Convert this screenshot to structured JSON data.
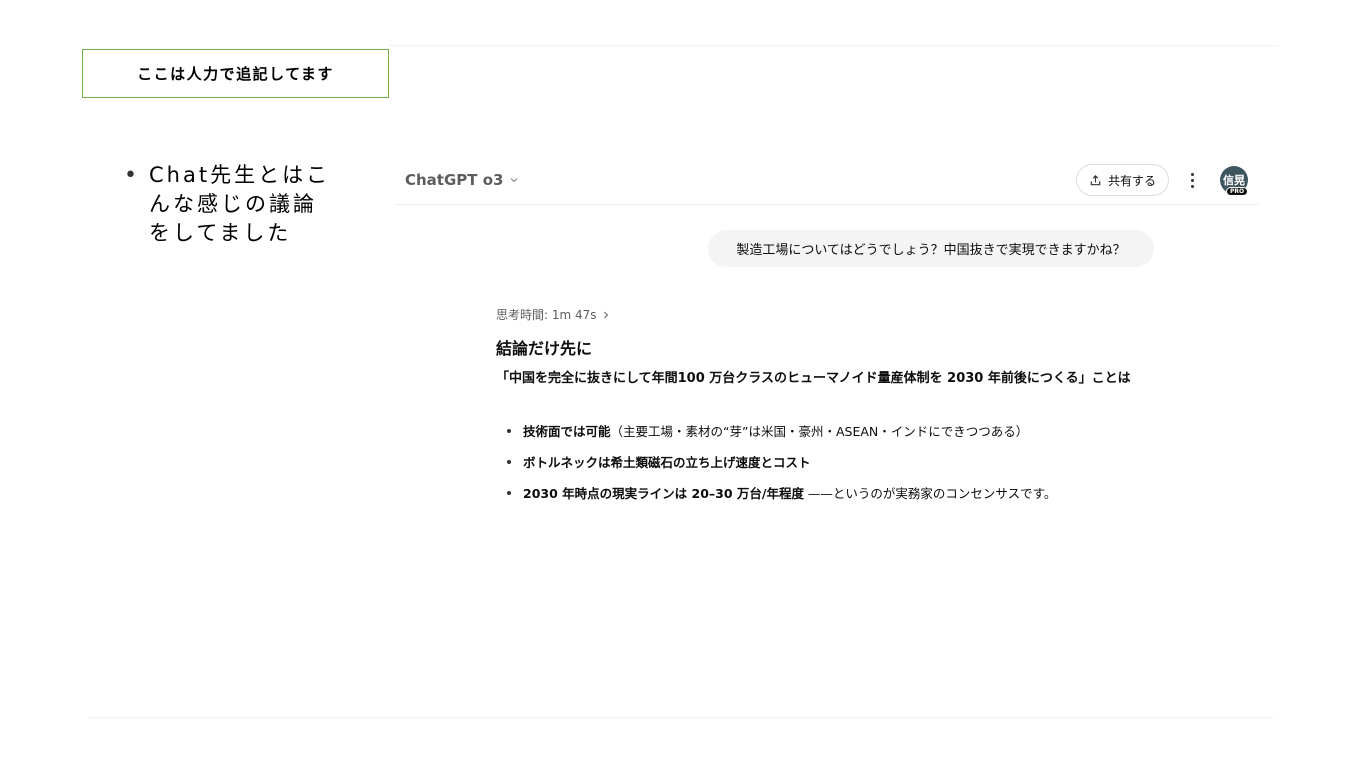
{
  "note": {
    "text": "ここは人力で追記してます"
  },
  "slide_bullet": {
    "text": "Chat先生とはこんな感じの議論をしてました"
  },
  "chat": {
    "model_name": "ChatGPT o3",
    "share_label": "共有する",
    "avatar_text": "信晃",
    "avatar_badge": "PRO",
    "user_message": "製造工場についてはどうでしょう？中国抜きで実現できますかね？",
    "thinking_time": "思考時間: 1m 47s",
    "answer_heading": "結論だけ先に",
    "answer_lead": "「中国を完全に抜きにして年間100 万台クラスのヒューマノイド量産体制を 2030 年前後につくる」ことは",
    "answer_items": [
      {
        "bold": "技術面では可能",
        "rest": "（主要工場・素材の“芽”は米国・豪州・ASEAN・インドにできつつある）"
      },
      {
        "bold": "ボトルネックは希土類磁石の立ち上げ速度とコスト",
        "rest": ""
      },
      {
        "bold": "2030 年時点の現実ラインは 20–30 万台/年程度",
        "rest": " ——というのが実務家のコンセンサスです。"
      }
    ]
  },
  "colors": {
    "note_border": "#70ad47",
    "bubble_bg": "#f4f4f4",
    "avatar_bg": "#3f5560"
  },
  "icons": [
    "chevron-down-icon",
    "share-icon",
    "more-vertical-icon",
    "chevron-right-icon"
  ]
}
